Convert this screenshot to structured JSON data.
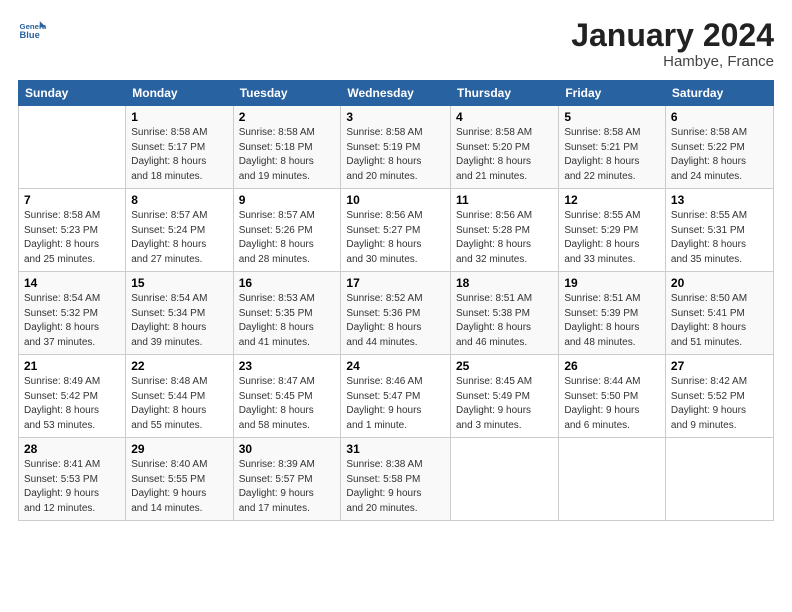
{
  "header": {
    "logo_general": "General",
    "logo_blue": "Blue",
    "month": "January 2024",
    "location": "Hambye, France"
  },
  "columns": [
    "Sunday",
    "Monday",
    "Tuesday",
    "Wednesday",
    "Thursday",
    "Friday",
    "Saturday"
  ],
  "weeks": [
    {
      "days": [
        {
          "num": "",
          "info": ""
        },
        {
          "num": "1",
          "info": "Sunrise: 8:58 AM\nSunset: 5:17 PM\nDaylight: 8 hours\nand 18 minutes."
        },
        {
          "num": "2",
          "info": "Sunrise: 8:58 AM\nSunset: 5:18 PM\nDaylight: 8 hours\nand 19 minutes."
        },
        {
          "num": "3",
          "info": "Sunrise: 8:58 AM\nSunset: 5:19 PM\nDaylight: 8 hours\nand 20 minutes."
        },
        {
          "num": "4",
          "info": "Sunrise: 8:58 AM\nSunset: 5:20 PM\nDaylight: 8 hours\nand 21 minutes."
        },
        {
          "num": "5",
          "info": "Sunrise: 8:58 AM\nSunset: 5:21 PM\nDaylight: 8 hours\nand 22 minutes."
        },
        {
          "num": "6",
          "info": "Sunrise: 8:58 AM\nSunset: 5:22 PM\nDaylight: 8 hours\nand 24 minutes."
        }
      ]
    },
    {
      "days": [
        {
          "num": "7",
          "info": "Sunrise: 8:58 AM\nSunset: 5:23 PM\nDaylight: 8 hours\nand 25 minutes."
        },
        {
          "num": "8",
          "info": "Sunrise: 8:57 AM\nSunset: 5:24 PM\nDaylight: 8 hours\nand 27 minutes."
        },
        {
          "num": "9",
          "info": "Sunrise: 8:57 AM\nSunset: 5:26 PM\nDaylight: 8 hours\nand 28 minutes."
        },
        {
          "num": "10",
          "info": "Sunrise: 8:56 AM\nSunset: 5:27 PM\nDaylight: 8 hours\nand 30 minutes."
        },
        {
          "num": "11",
          "info": "Sunrise: 8:56 AM\nSunset: 5:28 PM\nDaylight: 8 hours\nand 32 minutes."
        },
        {
          "num": "12",
          "info": "Sunrise: 8:55 AM\nSunset: 5:29 PM\nDaylight: 8 hours\nand 33 minutes."
        },
        {
          "num": "13",
          "info": "Sunrise: 8:55 AM\nSunset: 5:31 PM\nDaylight: 8 hours\nand 35 minutes."
        }
      ]
    },
    {
      "days": [
        {
          "num": "14",
          "info": "Sunrise: 8:54 AM\nSunset: 5:32 PM\nDaylight: 8 hours\nand 37 minutes."
        },
        {
          "num": "15",
          "info": "Sunrise: 8:54 AM\nSunset: 5:34 PM\nDaylight: 8 hours\nand 39 minutes."
        },
        {
          "num": "16",
          "info": "Sunrise: 8:53 AM\nSunset: 5:35 PM\nDaylight: 8 hours\nand 41 minutes."
        },
        {
          "num": "17",
          "info": "Sunrise: 8:52 AM\nSunset: 5:36 PM\nDaylight: 8 hours\nand 44 minutes."
        },
        {
          "num": "18",
          "info": "Sunrise: 8:51 AM\nSunset: 5:38 PM\nDaylight: 8 hours\nand 46 minutes."
        },
        {
          "num": "19",
          "info": "Sunrise: 8:51 AM\nSunset: 5:39 PM\nDaylight: 8 hours\nand 48 minutes."
        },
        {
          "num": "20",
          "info": "Sunrise: 8:50 AM\nSunset: 5:41 PM\nDaylight: 8 hours\nand 51 minutes."
        }
      ]
    },
    {
      "days": [
        {
          "num": "21",
          "info": "Sunrise: 8:49 AM\nSunset: 5:42 PM\nDaylight: 8 hours\nand 53 minutes."
        },
        {
          "num": "22",
          "info": "Sunrise: 8:48 AM\nSunset: 5:44 PM\nDaylight: 8 hours\nand 55 minutes."
        },
        {
          "num": "23",
          "info": "Sunrise: 8:47 AM\nSunset: 5:45 PM\nDaylight: 8 hours\nand 58 minutes."
        },
        {
          "num": "24",
          "info": "Sunrise: 8:46 AM\nSunset: 5:47 PM\nDaylight: 9 hours\nand 1 minute."
        },
        {
          "num": "25",
          "info": "Sunrise: 8:45 AM\nSunset: 5:49 PM\nDaylight: 9 hours\nand 3 minutes."
        },
        {
          "num": "26",
          "info": "Sunrise: 8:44 AM\nSunset: 5:50 PM\nDaylight: 9 hours\nand 6 minutes."
        },
        {
          "num": "27",
          "info": "Sunrise: 8:42 AM\nSunset: 5:52 PM\nDaylight: 9 hours\nand 9 minutes."
        }
      ]
    },
    {
      "days": [
        {
          "num": "28",
          "info": "Sunrise: 8:41 AM\nSunset: 5:53 PM\nDaylight: 9 hours\nand 12 minutes."
        },
        {
          "num": "29",
          "info": "Sunrise: 8:40 AM\nSunset: 5:55 PM\nDaylight: 9 hours\nand 14 minutes."
        },
        {
          "num": "30",
          "info": "Sunrise: 8:39 AM\nSunset: 5:57 PM\nDaylight: 9 hours\nand 17 minutes."
        },
        {
          "num": "31",
          "info": "Sunrise: 8:38 AM\nSunset: 5:58 PM\nDaylight: 9 hours\nand 20 minutes."
        },
        {
          "num": "",
          "info": ""
        },
        {
          "num": "",
          "info": ""
        },
        {
          "num": "",
          "info": ""
        }
      ]
    }
  ]
}
